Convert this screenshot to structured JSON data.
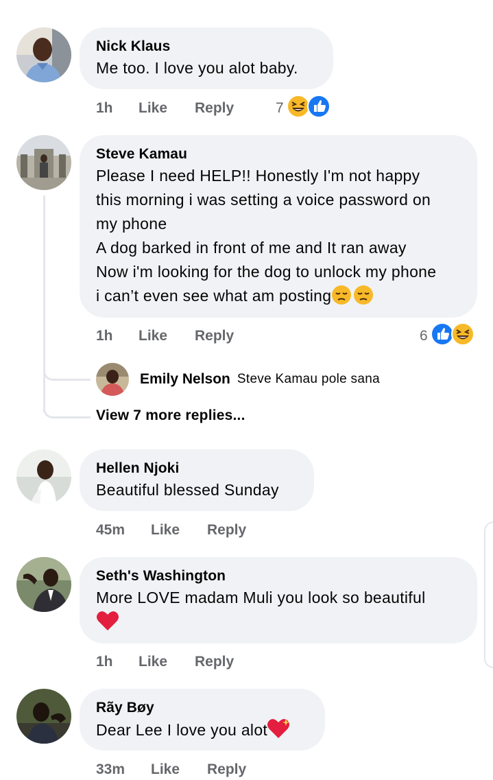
{
  "comments": [
    {
      "author": "Nick Klaus",
      "text": "Me too. I love you alot baby.",
      "time": "1h",
      "like_label": "Like",
      "reply_label": "Reply",
      "reaction_count": "7",
      "reactions": [
        "haha-icon",
        "like-icon"
      ]
    },
    {
      "author": "Steve Kamau",
      "text": "Please I need HELP!! Honestly I'm not happy\nthis morning i was setting a voice password on\nmy phone\nA dog barked in front of me and It ran away\nNow i'm looking for the dog to unlock my phone\ni can’t even see what am posting",
      "time": "1h",
      "like_label": "Like",
      "reply_label": "Reply",
      "reaction_count": "6",
      "reactions": [
        "like-icon",
        "haha-icon"
      ],
      "reply_preview": {
        "author": "Emily Nelson",
        "text": "Steve Kamau pole sana"
      },
      "view_more_label": "View 7 more replies..."
    },
    {
      "author": "Hellen Njoki",
      "text": "Beautiful blessed Sunday",
      "time": "45m",
      "like_label": "Like",
      "reply_label": "Reply"
    },
    {
      "author": "Seth's Washington",
      "text": "More LOVE madam Muli you look so beautiful",
      "time": "1h",
      "like_label": "Like",
      "reply_label": "Reply"
    },
    {
      "author": "Rãy Bøy",
      "text": "Dear Lee I love you alot",
      "time": "33m",
      "like_label": "Like",
      "reply_label": "Reply"
    }
  ],
  "colors": {
    "bubble_bg": "#f0f2f5",
    "meta_text": "#65676b",
    "like_blue": "#1877f2",
    "haha_yellow": "#f7b928",
    "heart_red": "#e41e3f"
  }
}
